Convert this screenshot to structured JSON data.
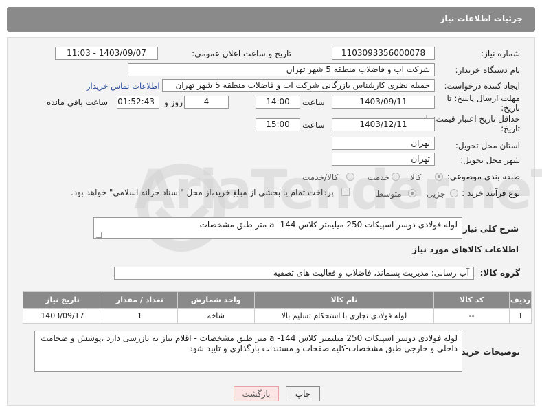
{
  "header": {
    "title": "جزئیات اطلاعات نیاز"
  },
  "fields": {
    "need_number_label": "شماره نیاز:",
    "need_number_value": "1103093356000078",
    "announce_label": "تاریخ و ساعت اعلان عمومی:",
    "announce_value": "1403/09/07 - 11:03",
    "buyer_org_label": "نام دستگاه خریدار:",
    "buyer_org_value": "شرکت اب و فاضلاب منطقه 5 شهر تهران",
    "creator_label": "ایجاد کننده درخواست:",
    "creator_value": "جمیله نظری کارشناس بازرگانی شرکت اب و فاضلاب منطقه 5 شهر تهران",
    "contact_link": "اطلاعات تماس خریدار",
    "deadline_label": "مهلت ارسال پاسخ: تا",
    "deadline_label2": "تاریخ:",
    "deadline_date": "1403/09/11",
    "time_label": "ساعت",
    "deadline_time": "14:00",
    "days_value": "4",
    "days_label": "روز و",
    "remaining_value": "01:52:43",
    "remaining_label": "ساعت باقی مانده",
    "validity_label": "حداقل تاریخ اعتبار قیمت: تا",
    "validity_label2": "تاریخ:",
    "validity_date": "1403/12/11",
    "validity_time_label": "ساعت",
    "validity_time": "15:00",
    "province_label": "استان محل تحویل:",
    "province_value": "تهران",
    "city_label": "شهر محل تحویل:",
    "city_value": "تهران",
    "category_label": "طبقه بندی موضوعی:",
    "category_options": [
      "کالا",
      "خدمت",
      "کالا/خدمت"
    ],
    "process_label": "نوع فرآیند خرید :",
    "process_options": [
      "جزیی",
      "متوسط"
    ],
    "payment_note": "پرداخت تمام یا بخشی از مبلغ خرید،از محل \"اسناد خزانه اسلامی\" خواهد بود.",
    "summary_label": "شرح کلی نیاز:",
    "summary_value": "لوله فولادی دوسر اسپیکات 250 میلیمتر کلاس 144- a متر طبق مشخصات",
    "goods_section": "اطلاعات کالاهای مورد نیاز",
    "goods_group_label": "گروه کالا:",
    "goods_group_value": "آب رسانی؛ مدیریت پسماند، فاضلاب و فعالیت های تصفیه",
    "buyer_notes_label": "توضیحات خریدار:",
    "buyer_notes_value": "لوله فولادی دوسر اسپیکات 250 میلیمتر کلاس 144- a متر طبق مشخصات - اقلام نیاز به بازرسی دارد ،پوشش و ضخامت داخلی و خارجی طبق مشخصات-کلیه صفحات و مستندات بارگذاری  و تایید شود"
  },
  "table": {
    "headers": [
      "ردیف",
      "کد کالا",
      "نام کالا",
      "واحد شمارش",
      "تعداد / مقدار",
      "تاریخ نیاز"
    ],
    "rows": [
      [
        "1",
        "--",
        "لوله فولادی تجاری با استحکام تسلیم بالا",
        "شاخه",
        "1",
        "1403/09/17"
      ]
    ]
  },
  "buttons": {
    "print": "چاپ",
    "back": "بازگشت"
  },
  "watermark": "AriaTender.neT"
}
